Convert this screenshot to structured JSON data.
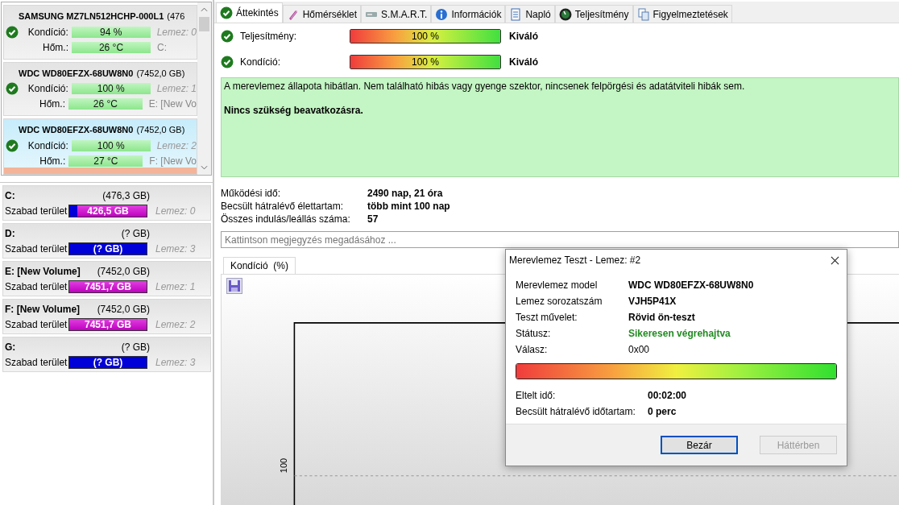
{
  "disks": [
    {
      "name": "SAMSUNG MZ7LN512HCHP-000L1",
      "size": "(476",
      "selected": false,
      "ok": true,
      "health_label": "Kondíció:",
      "health": "94 %",
      "temp_label": "Hőm.:",
      "temp": "26 °C",
      "disk_no": "Lemez: 0",
      "volumes": "C:"
    },
    {
      "name": "WDC WD80EFZX-68UW8N0",
      "size": "(7452,0 GB)",
      "selected": false,
      "ok": true,
      "health_label": "Kondíció:",
      "health": "100 %",
      "temp_label": "Hőm.:",
      "temp": "26 °C",
      "disk_no": "Lemez: 1",
      "volumes": "E: [New Vo"
    },
    {
      "name": "WDC WD80EFZX-68UW8N0",
      "size": "(7452,0 GB)",
      "selected": true,
      "ok": true,
      "health_label": "Kondíció:",
      "health": "100 %",
      "temp_label": "Hőm.:",
      "temp": "27 °C",
      "disk_no": "Lemez: 2",
      "volumes": "F: [New Vo"
    }
  ],
  "volumes": [
    {
      "name": "C:",
      "size": "(476,3 GB)",
      "free_label": "Szabad terület",
      "free": "426,5 GB",
      "level": 0.9,
      "disk_no": "Lemez: 0"
    },
    {
      "name": "D:",
      "size": "(? GB)",
      "free_label": "Szabad terület",
      "free": "(? GB)",
      "level": 0,
      "disk_no": "Lemez: 3"
    },
    {
      "name": "E: [New Volume]",
      "size": "(7452,0 GB)",
      "free_label": "Szabad terület",
      "free": "7451,7 GB",
      "level": 1,
      "disk_no": "Lemez: 1"
    },
    {
      "name": "F: [New Volume]",
      "size": "(7452,0 GB)",
      "free_label": "Szabad terület",
      "free": "7451,7 GB",
      "level": 1,
      "disk_no": "Lemez: 2"
    },
    {
      "name": "G:",
      "size": "(? GB)",
      "free_label": "Szabad terület",
      "free": "(? GB)",
      "level": 0,
      "disk_no": "Lemez: 3"
    }
  ],
  "tabs": [
    {
      "label": "Áttekintés",
      "selected": true
    },
    {
      "label": "Hőmérséklet",
      "selected": false
    },
    {
      "label": "S.M.A.R.T.",
      "selected": false
    },
    {
      "label": "Információk",
      "selected": false
    },
    {
      "label": "Napló",
      "selected": false
    },
    {
      "label": "Teljesítmény",
      "selected": false
    },
    {
      "label": "Figyelmeztetések",
      "selected": false
    }
  ],
  "overview": [
    {
      "label": "Teljesítmény:",
      "ok": true,
      "level": 1,
      "reading": "100 %",
      "rating": "Kiváló"
    },
    {
      "label": "Kondíció:",
      "ok": true,
      "level": 1,
      "reading": "100 %",
      "rating": "Kiváló"
    }
  ],
  "message": [
    {
      "text": "A merevlemez állapota hibátlan. Nem található hibás vagy gyenge szektor, nincsenek felpörgési és adatátviteli hibák sem.",
      "bold": false
    },
    {
      "text": "Nincs szükség beavatkozásra.",
      "bold": true
    }
  ],
  "stats": [
    {
      "label": "Működési idő:",
      "value": "2490 nap, 21 óra"
    },
    {
      "label": "Becsült hátralévő élettartam:",
      "value": "több mint 100 nap"
    },
    {
      "label": "Összes indulás/leállás száma:",
      "value": "57"
    }
  ],
  "note": {
    "placeholder": "Kattintson megjegyzés megadásához ..."
  },
  "chart_tab": {
    "label": "Kondíció  (%)",
    "selected": true
  },
  "chart": {
    "kind": "picture",
    "tick": "100"
  },
  "dialog": {
    "title": "Merevlemez Teszt - Lemez: #2",
    "rows": [
      {
        "label": "Merevlemez model",
        "value": "WDC WD80EFZX-68UW8N0",
        "bold": true,
        "success": false
      },
      {
        "label": "Lemez sorozatszám",
        "value": "VJH5P41X",
        "bold": true,
        "success": false
      },
      {
        "label": "Teszt művelet:",
        "value": "Rövid ön-teszt",
        "bold": true,
        "success": false
      },
      {
        "label": "Státusz:",
        "value": "Sikeresen végrehajtva",
        "bold": true,
        "success": true
      },
      {
        "label": "Válasz:",
        "value": "0x00",
        "bold": false,
        "success": false
      }
    ],
    "level": 1,
    "times": [
      {
        "label": "Eltelt idő:",
        "value": "00:02:00"
      },
      {
        "label": "Becsült hátralévő időtartam:",
        "value": "0 perc"
      }
    ],
    "buttons": [
      {
        "label": "Bezár",
        "default": true,
        "disabled": false
      },
      {
        "label": "Háttérben",
        "default": false,
        "disabled": true
      }
    ]
  }
}
